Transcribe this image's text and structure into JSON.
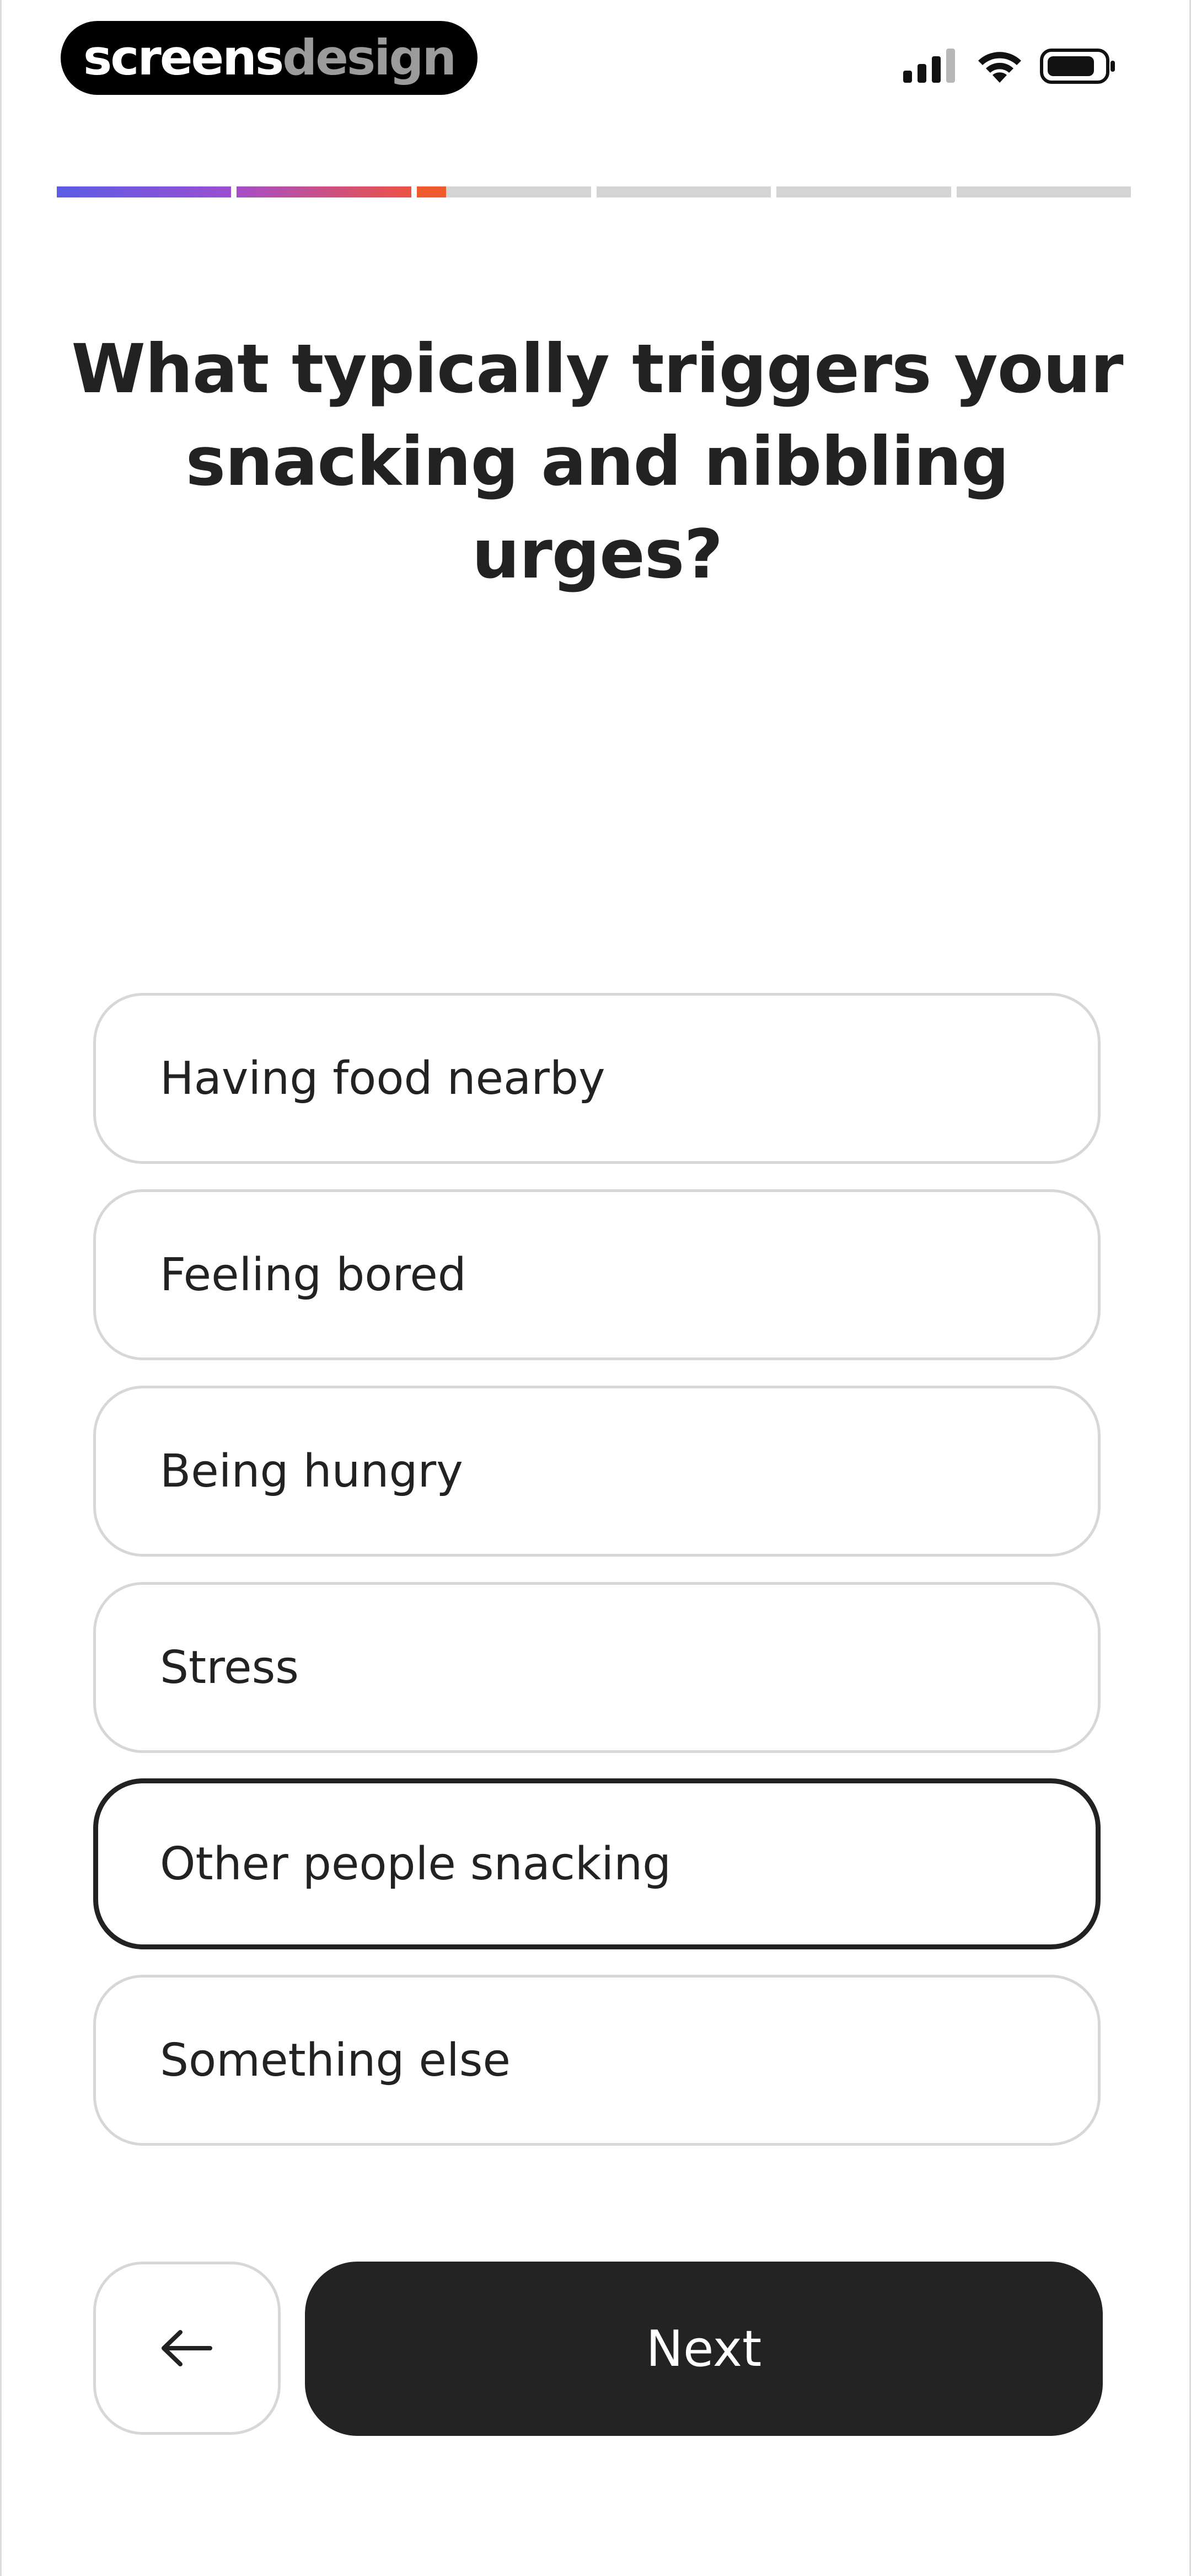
{
  "status_bar": {
    "brand_part_1": "screens",
    "brand_part_2": "design",
    "icons": [
      "signal-icon",
      "wifi-icon",
      "battery-icon"
    ]
  },
  "progress": {
    "total_steps": 6,
    "segments": [
      {
        "fill": 1.0,
        "gradient": [
          "#5b5ce6",
          "#9b4fd0"
        ]
      },
      {
        "fill": 1.0,
        "gradient": [
          "#a64ec8",
          "#ec5344"
        ]
      },
      {
        "fill": 0.17,
        "gradient": [
          "#ef5a2f",
          "#ef5a2f"
        ]
      },
      {
        "fill": 0.0,
        "gradient": [
          "#d4d4d4",
          "#d4d4d4"
        ]
      },
      {
        "fill": 0.0,
        "gradient": [
          "#d4d4d4",
          "#d4d4d4"
        ]
      },
      {
        "fill": 0.0,
        "gradient": [
          "#d4d4d4",
          "#d4d4d4"
        ]
      }
    ]
  },
  "question": {
    "line1": "What typically triggers your",
    "line2": "snacking and nibbling urges?"
  },
  "options": [
    {
      "label": "Having food nearby",
      "selected": false
    },
    {
      "label": "Feeling bored",
      "selected": false
    },
    {
      "label": "Being hungry",
      "selected": false
    },
    {
      "label": "Stress",
      "selected": false
    },
    {
      "label": "Other people snacking",
      "selected": true
    },
    {
      "label": "Something else",
      "selected": false
    }
  ],
  "actions": {
    "back_icon": "arrow-left-icon",
    "next_label": "Next"
  },
  "colors": {
    "text": "#222222",
    "button_dark": "#232323",
    "border_light": "#d7d7d7",
    "progress_empty": "#d4d4d4"
  }
}
